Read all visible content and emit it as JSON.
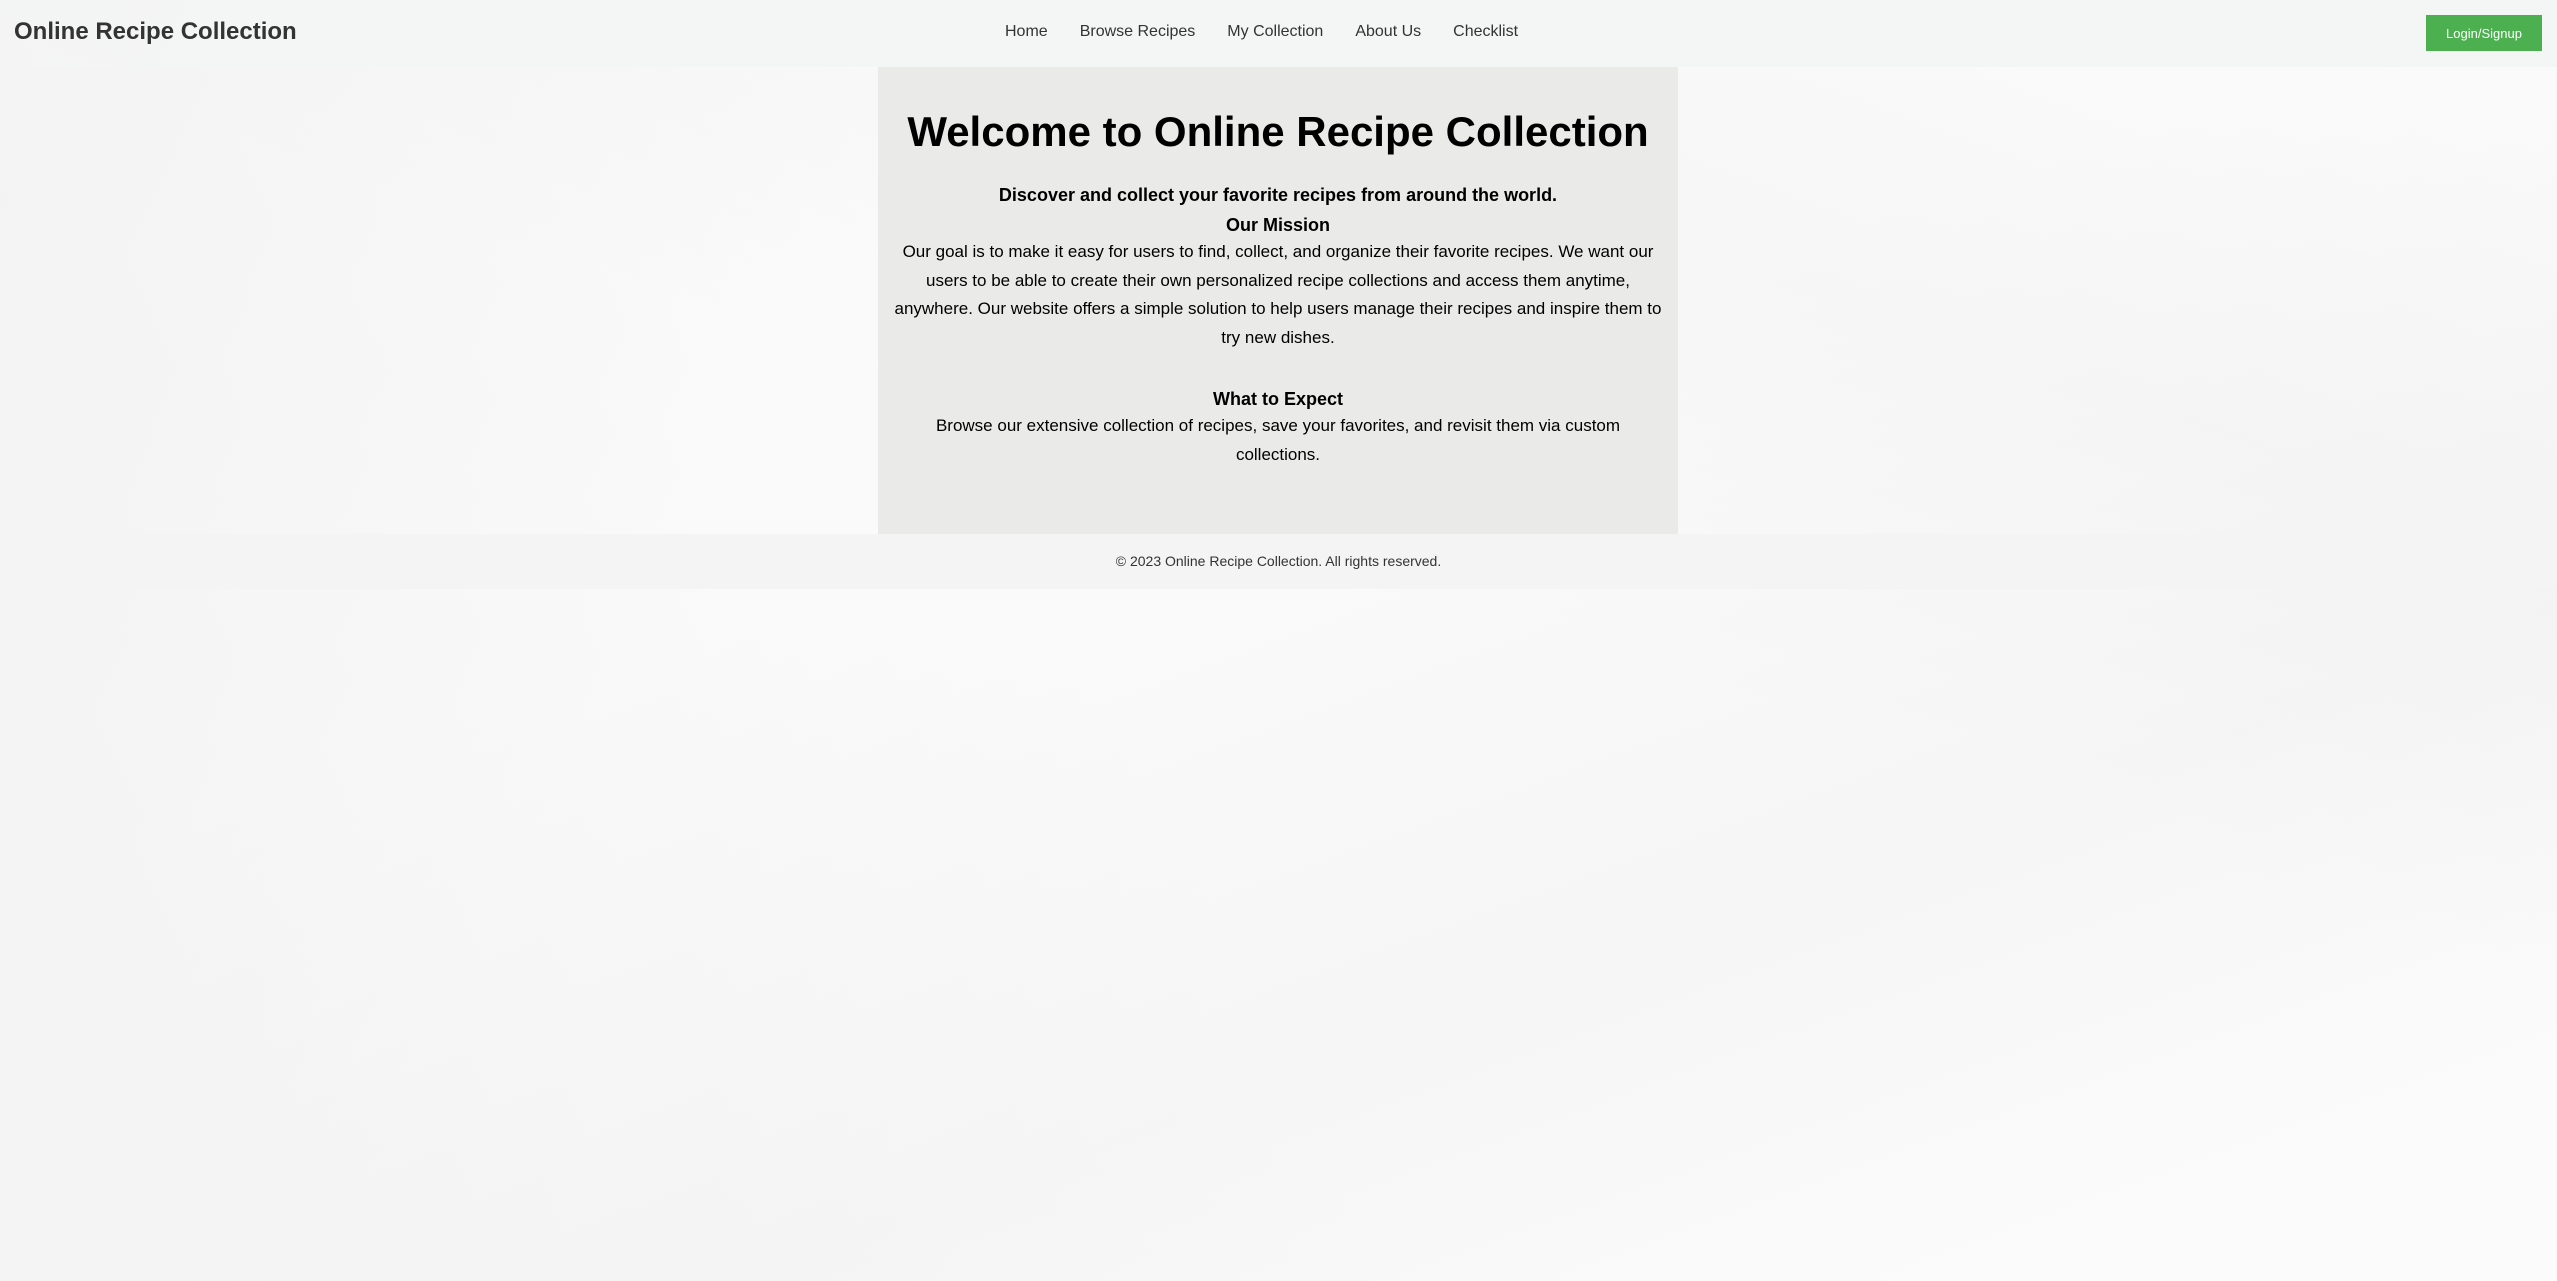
{
  "header": {
    "site_title": "Online Recipe Collection",
    "nav": [
      {
        "label": "Home"
      },
      {
        "label": "Browse Recipes"
      },
      {
        "label": "My Collection"
      },
      {
        "label": "About Us"
      },
      {
        "label": "Checklist"
      }
    ],
    "login_label": "Login/Signup"
  },
  "main": {
    "title": "Welcome to Online Recipe Collection",
    "tagline": "Discover and collect your favorite recipes from around the world.",
    "mission_heading": "Our Mission",
    "mission_text": "Our goal is to make it easy for users to find, collect, and organize their favorite recipes. We want our users to be able to create their own personalized recipe collections and access them anytime, anywhere. Our website offers a simple solution to help users manage their recipes and inspire them to try new dishes.",
    "expect_heading": "What to Expect",
    "expect_text": "Browse our extensive collection of recipes, save your favorites, and revisit them via custom collections."
  },
  "footer": {
    "copyright": "© 2023 Online Recipe Collection. All rights reserved."
  },
  "colors": {
    "accent": "#4caf50",
    "header_bg": "#f3f4f4",
    "card_bg": "#e8e8e7",
    "text": "#333333"
  }
}
